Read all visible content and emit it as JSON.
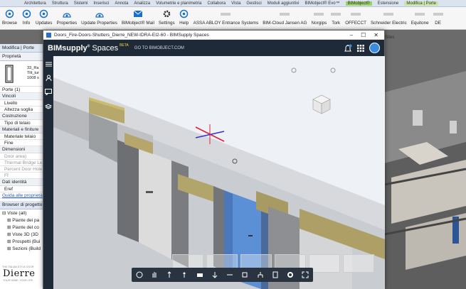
{
  "ribbon_tabs": [
    "Architettura",
    "Struttura",
    "Sistemi",
    "Inserisci",
    "Annota",
    "Analizza",
    "Volumetrie e planimetria",
    "Collabora",
    "Vista",
    "Gestisci",
    "Moduli aggiuntivi",
    "BIMobject® Evo™",
    "BIMobject®",
    "Estensione",
    "Modifica | Porte"
  ],
  "ribbon_buttons": [
    {
      "label": "Browse",
      "icon": "browse-icon"
    },
    {
      "label": "Info",
      "icon": "info-icon"
    },
    {
      "label": "Updates",
      "icon": "updates-icon"
    },
    {
      "label": "Properties",
      "icon": "properties-icon"
    },
    {
      "label": "Update Properties",
      "icon": "update-properties-icon"
    },
    {
      "label": "BIMobject® Mail",
      "icon": "mail-icon"
    },
    {
      "label": "Settings",
      "icon": "settings-icon"
    },
    {
      "label": "Help",
      "icon": "help-icon"
    },
    {
      "label": "ASSA ABLOY Entrance Systems",
      "icon": "assa-abloy-logo"
    },
    {
      "label": "BIM-Cloud Jansen AG",
      "icon": "jansen-logo"
    },
    {
      "label": "Norgips",
      "icon": "norgips-logo"
    },
    {
      "label": "Tork",
      "icon": "tork-logo"
    },
    {
      "label": "OFFECCT",
      "icon": "offecct-logo"
    },
    {
      "label": "Schneider Electric",
      "icon": "schneider-logo"
    },
    {
      "label": "Equitone",
      "icon": "equitone-logo"
    },
    {
      "label": "DE",
      "icon": "more-logo"
    }
  ],
  "context": {
    "modifica_label": "Modifica | Porte",
    "sites_label": "Sites"
  },
  "properties": {
    "header": "Proprietà",
    "type_name_1": "33_Ra",
    "type_name_2": "Tilt_tur",
    "type_name_3": "1008 s",
    "instance": "Porte (1)",
    "sections": [
      {
        "title": "Vincoli",
        "rows": [
          "Livello",
          "Altezza soglia"
        ]
      },
      {
        "title": "Costruzione",
        "rows": [
          "Tipo di telaio"
        ]
      },
      {
        "title": "Materiali e finiture",
        "rows": [
          "Materiale telaio",
          "Fine"
        ]
      },
      {
        "title": "Dimensioni",
        "rows": [
          "Door area)",
          "Thermal Bridge Le",
          "Percent Door Hole",
          "Ff"
        ]
      },
      {
        "title": "Dati identità",
        "rows": [
          "Eref"
        ]
      }
    ],
    "help_link": "Guida alle proprietà"
  },
  "browser": {
    "header": "Browser di progetto -",
    "items": [
      "Viste (all)",
      "Piante dei pa",
      "Piante del co",
      "Viste 3D (3D",
      "Prospetti (Bui",
      "Sezioni (Build"
    ]
  },
  "brand": {
    "tagline": "THE ITALIAN STYLE DOOR",
    "name": "Dierre",
    "sub": "YOUR HOME. YOUR LIFE."
  },
  "bim_window": {
    "title": "Doors_Fire-Doors-Shutters_Dierre_NEW-IDRA-EI2-60 - BIMSupply Spaces",
    "brand": "BIMsupply",
    "brand2": "Spaces",
    "beta": "BETA",
    "goto": "GO TO BIMOBJECT.COM",
    "controls": [
      "–",
      "☐",
      "✕"
    ]
  },
  "colors": {
    "accent": "#3a8dde",
    "dark": "#1e2a38",
    "door_blue": "#5b8fd6"
  }
}
